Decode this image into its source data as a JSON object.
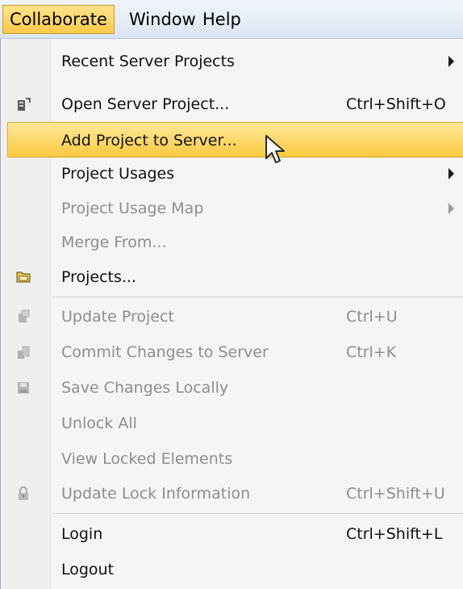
{
  "menubar": {
    "items": [
      {
        "label": "Collaborate",
        "active": true
      },
      {
        "label": "Window"
      },
      {
        "label": "Help"
      }
    ]
  },
  "menu": {
    "items": [
      {
        "label": "Recent Server Projects",
        "submenu": true
      },
      {
        "label": "Open Server Project...",
        "shortcut": "Ctrl+Shift+O",
        "icon": "server-open-icon"
      },
      {
        "label": "Add Project to Server...",
        "highlighted": true
      },
      {
        "label": "Project Usages",
        "submenu": true
      },
      {
        "label": "Project Usage Map",
        "submenu": true,
        "disabled": true
      },
      {
        "label": "Merge From...",
        "disabled": true
      },
      {
        "label": "Projects...",
        "icon": "folder-projects-icon"
      },
      {
        "label": "Update Project",
        "shortcut": "Ctrl+U",
        "disabled": true,
        "icon": "update-project-icon"
      },
      {
        "label": "Commit Changes to Server",
        "shortcut": "Ctrl+K",
        "disabled": true,
        "icon": "commit-icon"
      },
      {
        "label": "Save Changes Locally",
        "disabled": true,
        "icon": "save-icon"
      },
      {
        "label": "Unlock All",
        "disabled": true
      },
      {
        "label": "View Locked Elements",
        "disabled": true
      },
      {
        "label": "Update Lock Information",
        "shortcut": "Ctrl+Shift+U",
        "disabled": true,
        "icon": "lock-update-icon"
      },
      {
        "label": "Login",
        "shortcut": "Ctrl+Shift+L"
      },
      {
        "label": "Logout"
      }
    ]
  }
}
